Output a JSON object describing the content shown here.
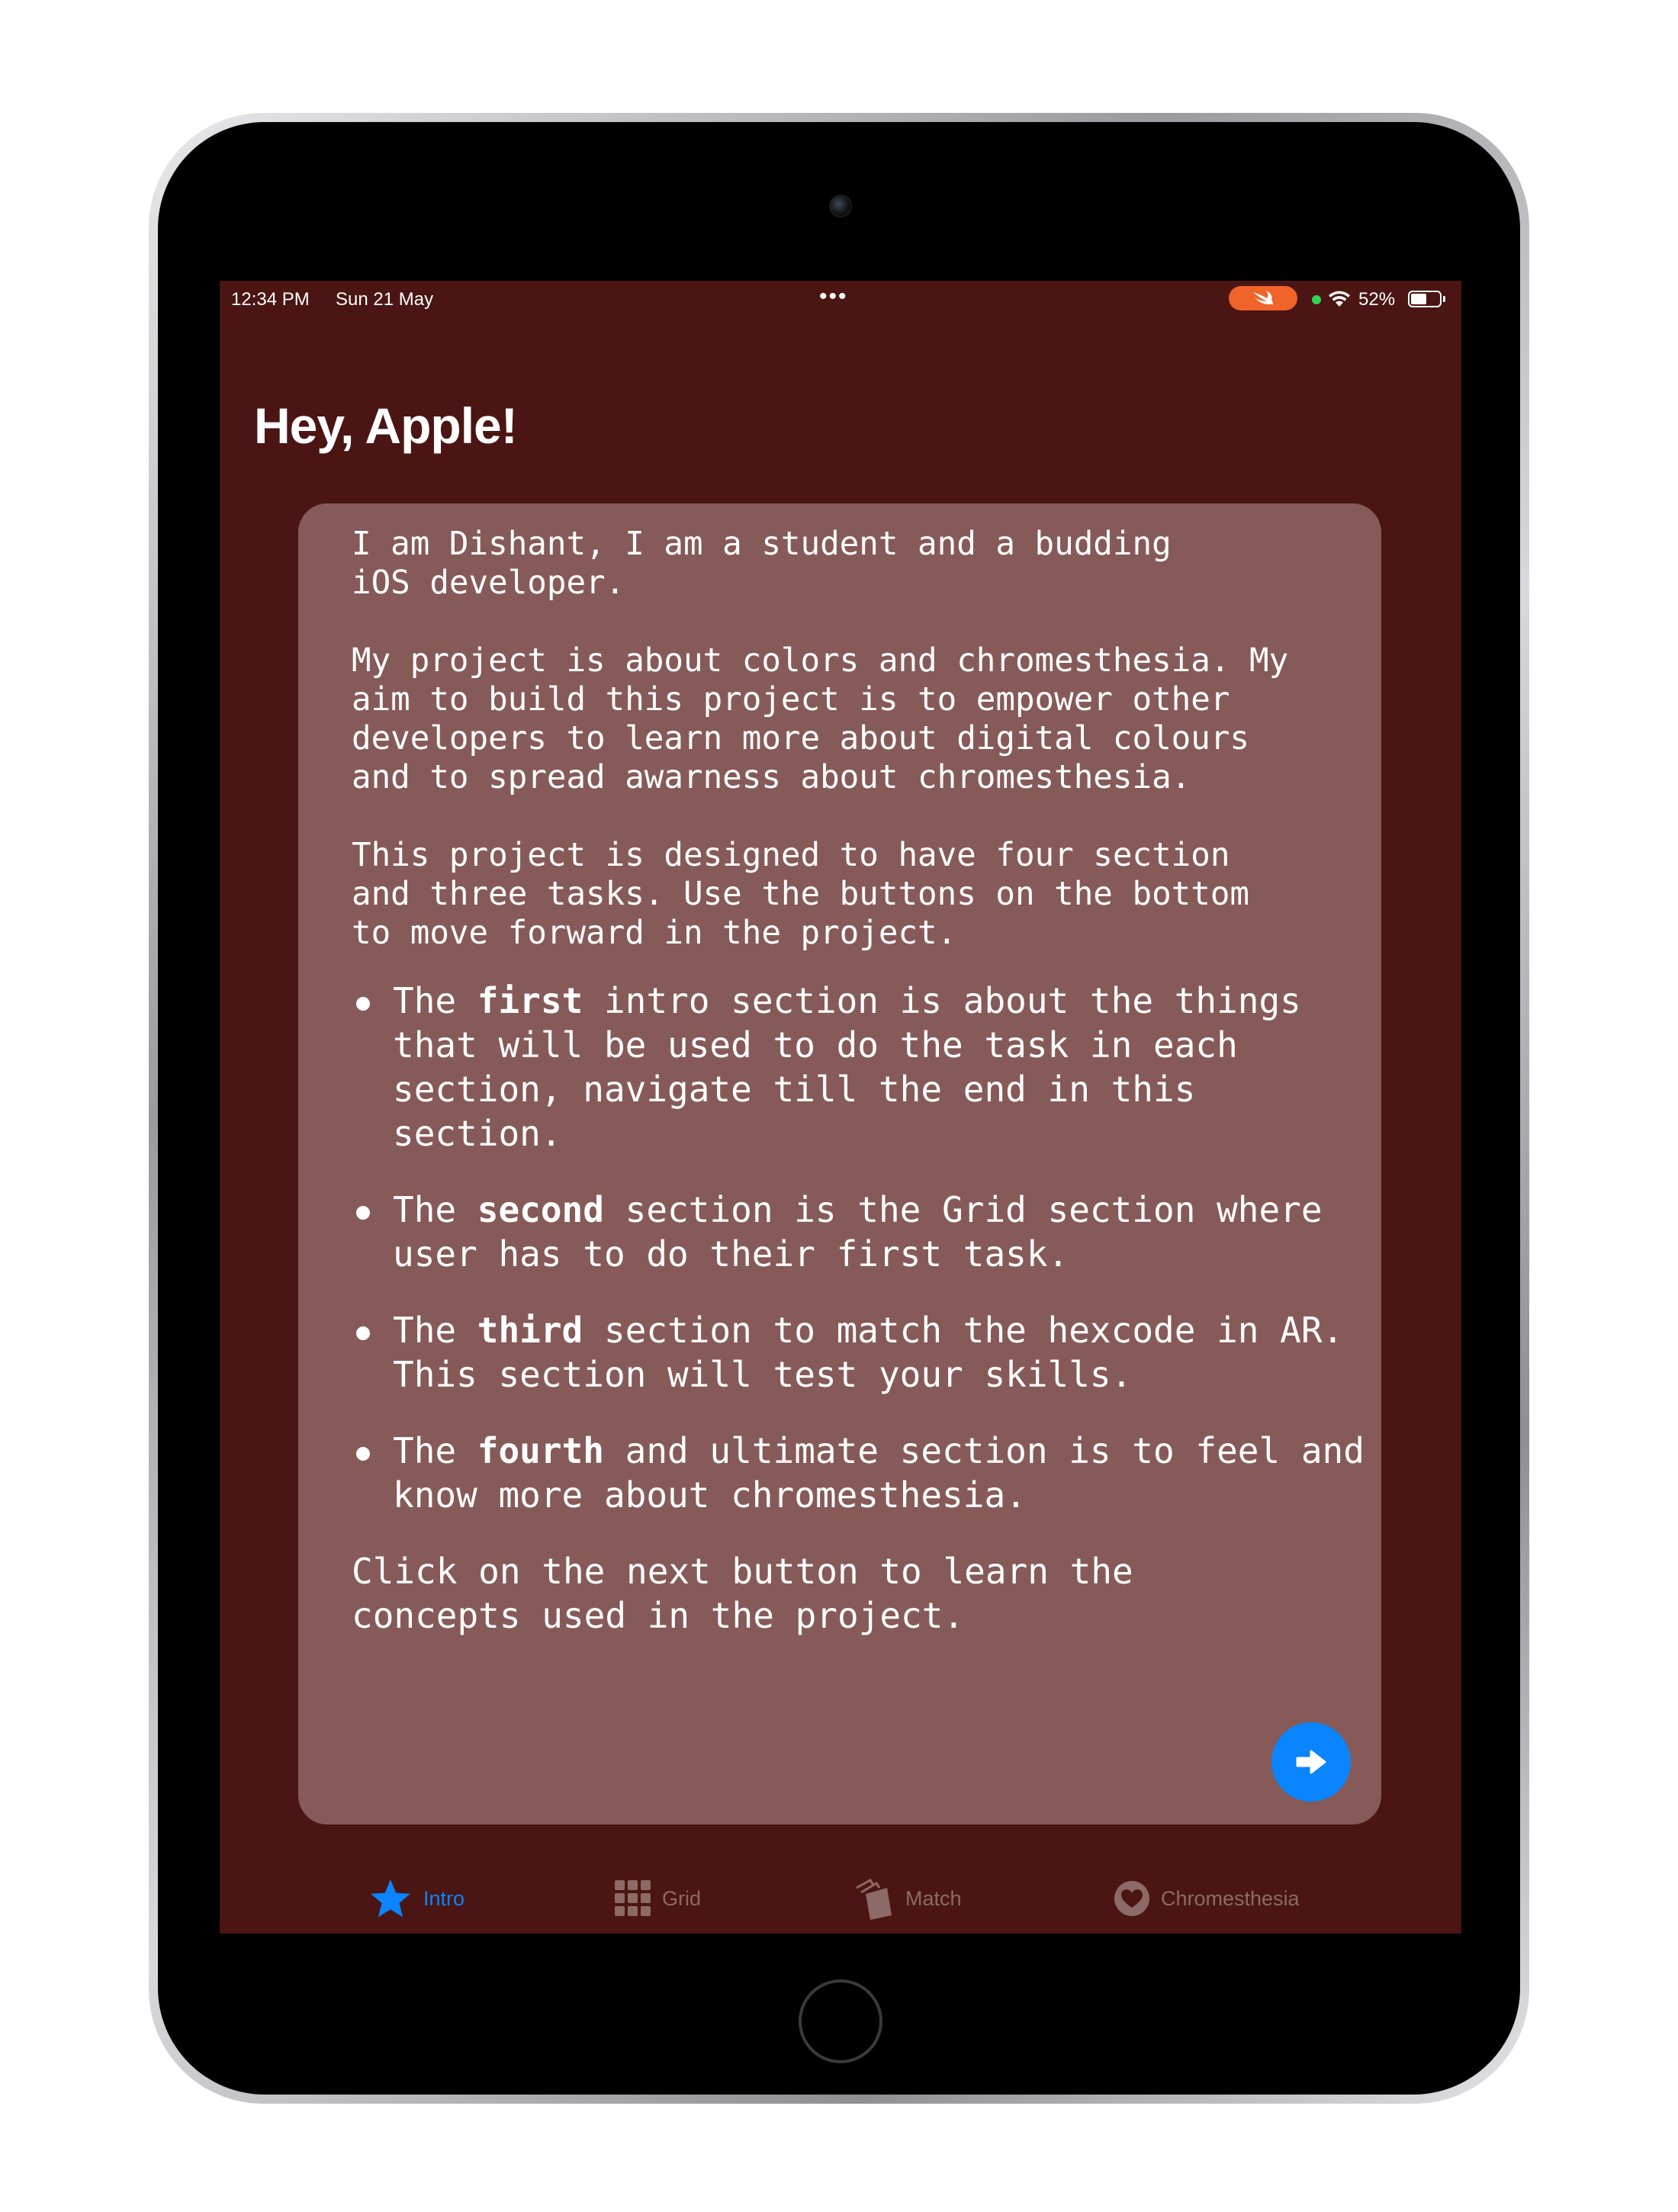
{
  "status_bar": {
    "time": "12:34 PM",
    "date": "Sun 21 May",
    "multitask_dots": "•••",
    "battery": "52%"
  },
  "page": {
    "title": "Hey, Apple!"
  },
  "card": {
    "intro_paragraphs": [
      "I am Dishant, I am a student and a budding\niOS developer.",
      "My project is about colors and chromesthesia. My\naim to build this project is to empower other\ndevelopers to learn more about digital colours\nand to spread awarness about chromesthesia.",
      "This project is designed to have four section\nand three tasks. Use the buttons on the bottom\nto move forward in the project."
    ],
    "list_items": [
      {
        "prefix": "The ",
        "bold": "first",
        "suffix": " intro section is about the things that will be used to do the task in each section, navigate till the end in this section."
      },
      {
        "prefix": "The ",
        "bold": "second",
        "suffix": " section is the Grid section where user has to do their first task."
      },
      {
        "prefix": "The ",
        "bold": "third",
        "suffix": " section to match the hexcode in AR. This section will test your skills."
      },
      {
        "prefix": "The ",
        "bold": "fourth",
        "suffix": " and ultimate section is to feel and know more about chromesthesia."
      }
    ],
    "closing": "Click on the next button to learn the\nconcepts used in the project.",
    "next_button_icon": "arrow-right-circle-icon"
  },
  "tabs": [
    {
      "label": "Intro",
      "icon": "star-icon",
      "active": true
    },
    {
      "label": "Grid",
      "icon": "grid-icon",
      "active": false
    },
    {
      "label": "Match",
      "icon": "cards-icon",
      "active": false
    },
    {
      "label": "Chromesthesia",
      "icon": "heart-circle-icon",
      "active": false
    }
  ],
  "colors": {
    "background": "#4a1512",
    "card": "#865a58",
    "accent": "#0a84ff",
    "tab_inactive": "#8c6a68",
    "swift_pill": "#f0642a"
  }
}
